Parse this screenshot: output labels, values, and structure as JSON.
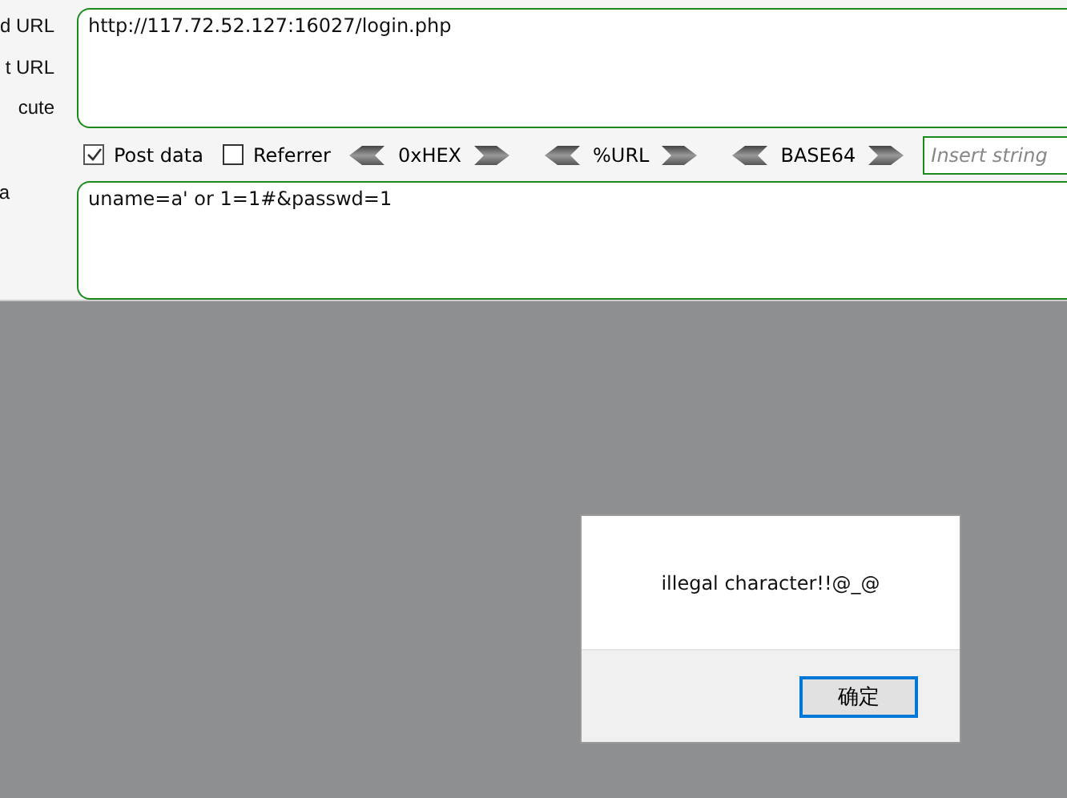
{
  "side_labels": [
    "d URL",
    "t URL",
    "cute",
    "a"
  ],
  "url_field": {
    "value": "http://117.72.52.127:16027/login.php"
  },
  "options": [
    {
      "label": "Post data",
      "checked": true
    },
    {
      "label": "Referrer",
      "checked": false
    }
  ],
  "encoders": [
    "0xHEX",
    "%URL",
    "BASE64"
  ],
  "insert_field": {
    "placeholder": "Insert string"
  },
  "post_field": {
    "value": "uname=a' or 1=1#&passwd=1"
  },
  "dialog": {
    "message": "illegal character!!@_@",
    "button": "确定"
  }
}
